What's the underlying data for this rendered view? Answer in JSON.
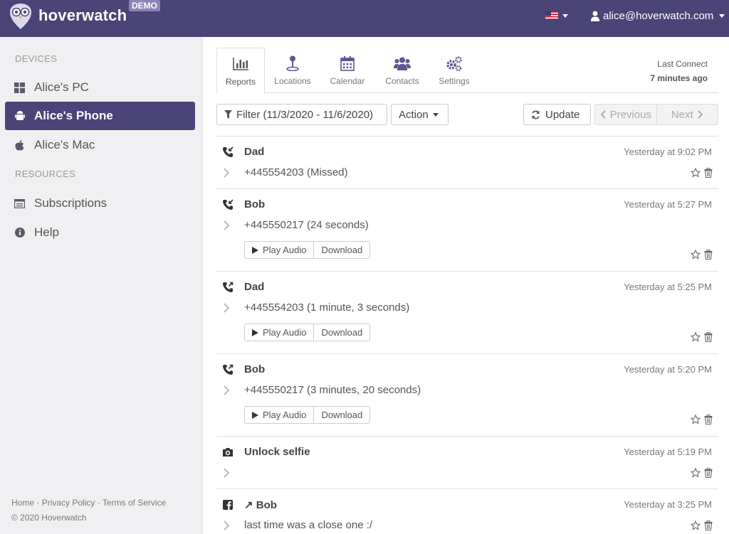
{
  "header": {
    "brand": "hoverwatch",
    "badge": "DEMO",
    "user_email": "alice@hoverwatch.com",
    "flag_icon": "us-flag-icon",
    "accent": "#4a4477"
  },
  "sidebar": {
    "devices_heading": "DEVICES",
    "devices": [
      {
        "label": "Alice's PC",
        "icon": "windows-icon"
      },
      {
        "label": "Alice's Phone",
        "icon": "android-icon",
        "active": true
      },
      {
        "label": "Alice's Mac",
        "icon": "apple-icon"
      }
    ],
    "resources_heading": "RESOURCES",
    "resources": [
      {
        "label": "Subscriptions",
        "icon": "subscriptions-icon"
      },
      {
        "label": "Help",
        "icon": "info-icon"
      }
    ],
    "footer": {
      "home": "Home",
      "privacy": "Privacy Policy",
      "terms": "Terms of Service",
      "sep": "·",
      "copyright": "© 2020 Hoverwatch"
    }
  },
  "tabs": [
    {
      "label": "Reports",
      "icon": "bar-chart-icon",
      "active": true
    },
    {
      "label": "Locations",
      "icon": "map-pin-icon"
    },
    {
      "label": "Calendar",
      "icon": "calendar-icon"
    },
    {
      "label": "Contacts",
      "icon": "users-icon"
    },
    {
      "label": "Settings",
      "icon": "gears-icon"
    }
  ],
  "last_connect": {
    "label": "Last Connect",
    "value": "7 minutes ago"
  },
  "toolbar": {
    "filter_label": "Filter (11/3/2020 - 11/6/2020)",
    "action_label": "Action",
    "update_label": "Update",
    "previous_label": "Previous",
    "next_label": "Next"
  },
  "audio_buttons": {
    "play": "Play Audio",
    "download": "Download"
  },
  "entries": [
    {
      "icon": "phone-incoming-icon",
      "who": "Dad",
      "time": "Yesterday at 9:02 PM",
      "detail": "+445554203 (Missed)",
      "audio": false
    },
    {
      "icon": "phone-incoming-icon",
      "who": "Bob",
      "time": "Yesterday at 5:27 PM",
      "detail": "+445550217 (24 seconds)",
      "audio": true
    },
    {
      "icon": "phone-outgoing-icon",
      "who": "Dad",
      "time": "Yesterday at 5:25 PM",
      "detail": "+445554203 (1 minute, 3 seconds)",
      "audio": true
    },
    {
      "icon": "phone-outgoing-icon",
      "who": "Bob",
      "time": "Yesterday at 5:20 PM",
      "detail": "+445550217 (3 minutes, 20 seconds)",
      "audio": true
    },
    {
      "icon": "camera-icon",
      "who": "Unlock selfie",
      "time": "Yesterday at 5:19 PM",
      "detail": "",
      "audio": false
    },
    {
      "icon": "facebook-icon",
      "who": "↗ Bob",
      "time": "Yesterday at 3:25 PM",
      "detail": "last time was a close one :/",
      "audio": false
    }
  ]
}
